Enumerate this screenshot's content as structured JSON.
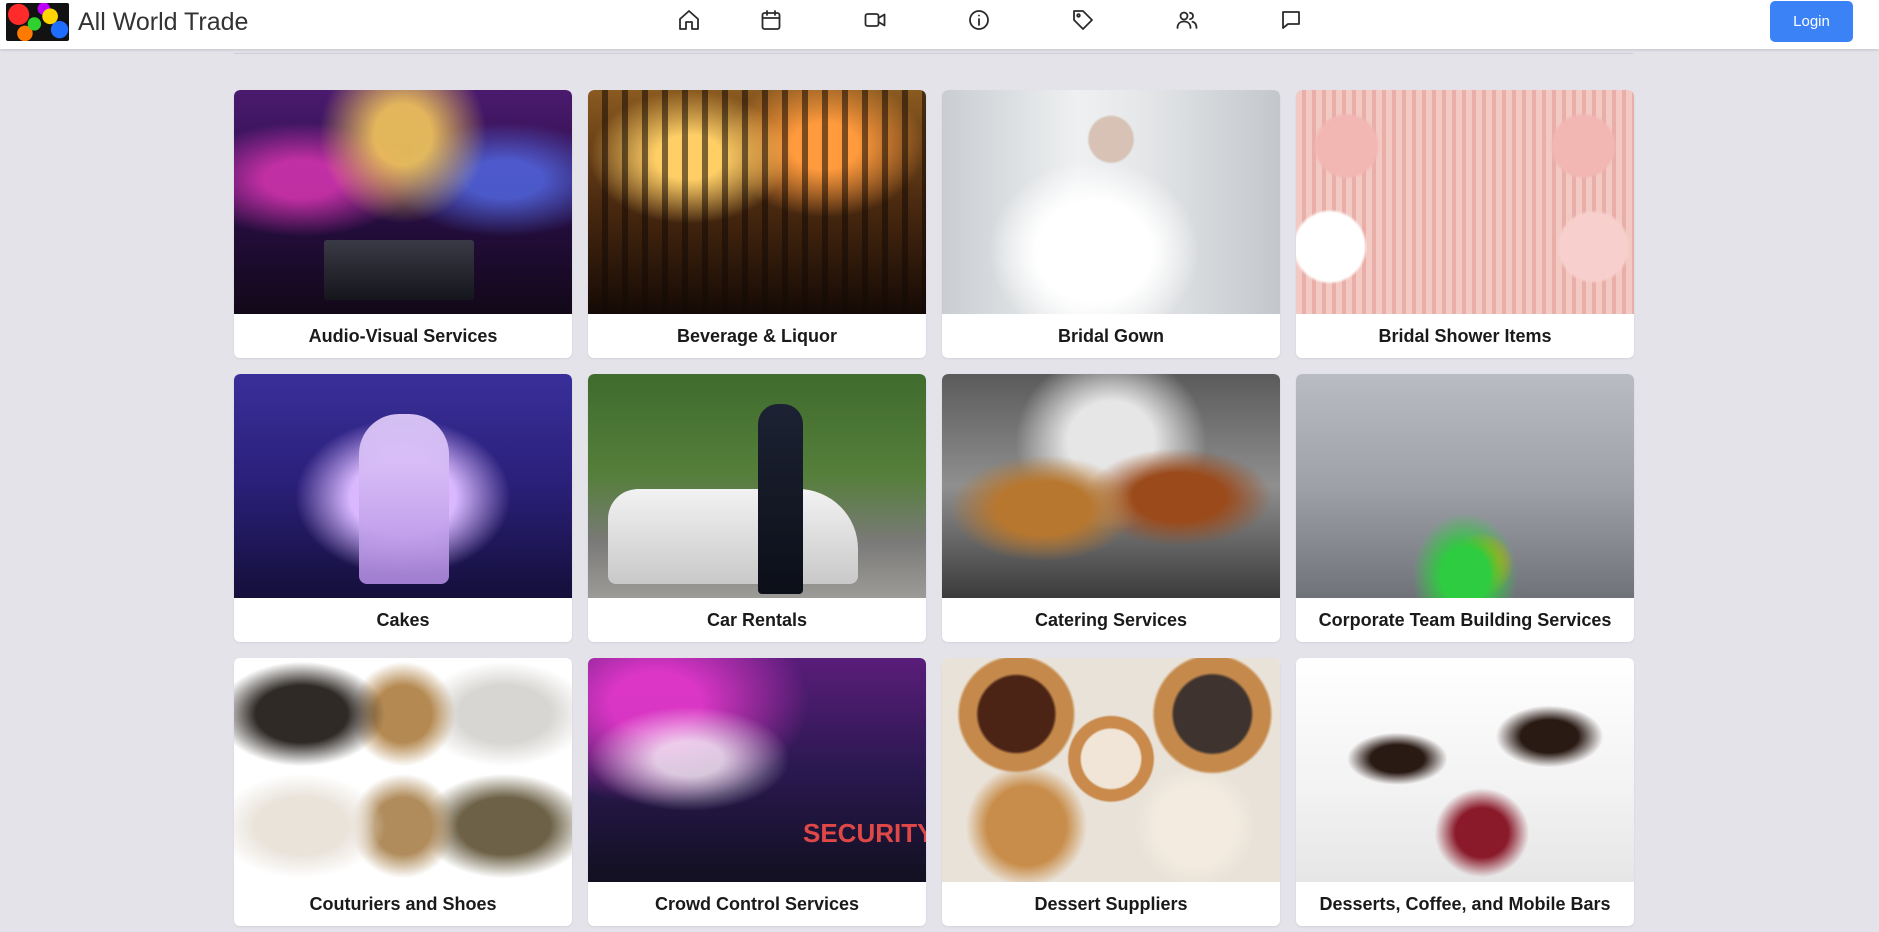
{
  "app": {
    "title": "All World Trade"
  },
  "header": {
    "nav": [
      {
        "icon": "home-icon"
      },
      {
        "icon": "calendar-icon"
      },
      {
        "icon": "video-icon"
      },
      {
        "icon": "info-icon"
      },
      {
        "icon": "tag-icon"
      },
      {
        "icon": "users-icon"
      },
      {
        "icon": "chat-icon"
      }
    ],
    "login_label": "Login",
    "login_color": "#3b82f6"
  },
  "categories": [
    {
      "label": "Audio-Visual Services"
    },
    {
      "label": "Beverage & Liquor"
    },
    {
      "label": "Bridal Gown"
    },
    {
      "label": "Bridal Shower Items"
    },
    {
      "label": "Cakes"
    },
    {
      "label": "Car Rentals"
    },
    {
      "label": "Catering Services"
    },
    {
      "label": "Corporate Team Building Services"
    },
    {
      "label": "Couturiers and Shoes"
    },
    {
      "label": "Crowd Control Services"
    },
    {
      "label": "Dessert Suppliers"
    },
    {
      "label": "Desserts, Coffee, and Mobile Bars"
    }
  ]
}
